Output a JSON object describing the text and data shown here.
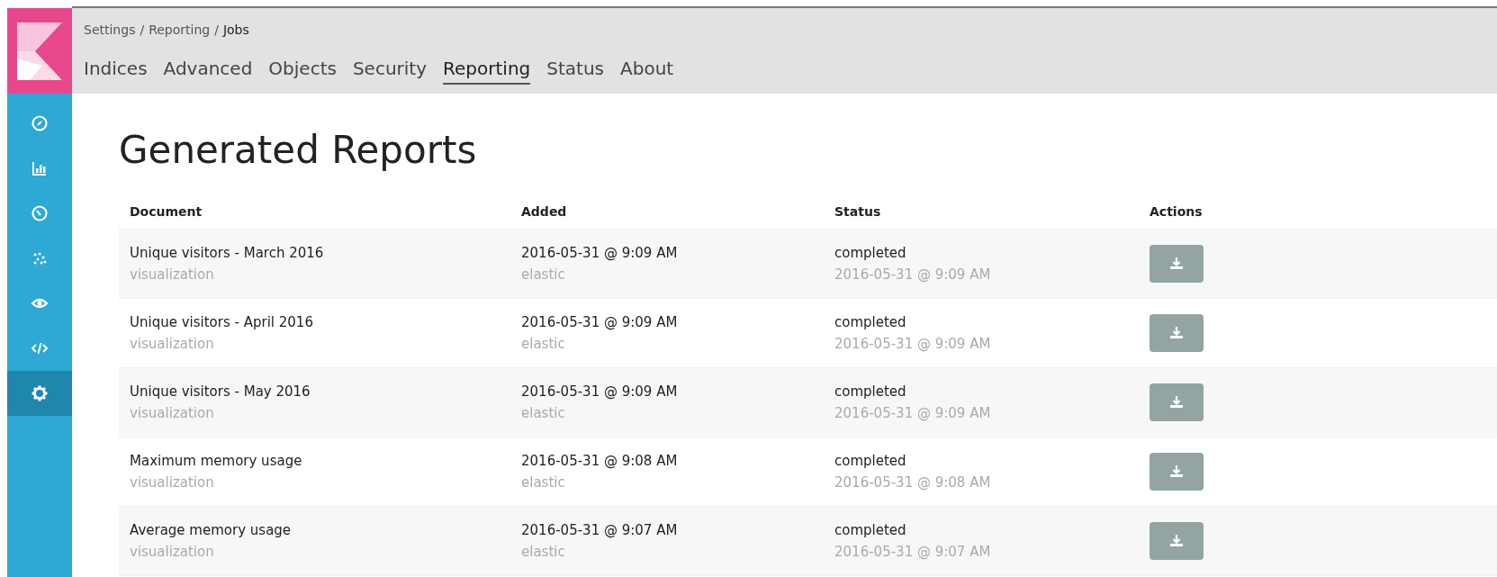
{
  "breadcrumb_separator": "/",
  "breadcrumb": [
    {
      "label": "Settings",
      "current": false
    },
    {
      "label": "Reporting",
      "current": false
    },
    {
      "label": "Jobs",
      "current": true
    }
  ],
  "tabs": [
    {
      "label": "Indices",
      "selected": false
    },
    {
      "label": "Advanced",
      "selected": false
    },
    {
      "label": "Objects",
      "selected": false
    },
    {
      "label": "Security",
      "selected": false
    },
    {
      "label": "Reporting",
      "selected": true
    },
    {
      "label": "Status",
      "selected": false
    },
    {
      "label": "About",
      "selected": false
    }
  ],
  "sidebar": {
    "items": [
      {
        "kind": "compass",
        "selected": false
      },
      {
        "kind": "chart",
        "selected": false
      },
      {
        "kind": "gauge",
        "selected": false
      },
      {
        "kind": "scatter",
        "selected": false
      },
      {
        "kind": "eye",
        "selected": false
      },
      {
        "kind": "code",
        "selected": false
      },
      {
        "kind": "gear",
        "selected": true
      }
    ]
  },
  "title": "Generated Reports",
  "table": {
    "columns": [
      "Document",
      "Added",
      "Status",
      "Actions"
    ],
    "rows": [
      {
        "document": "Unique visitors - March 2016",
        "type": "visualization",
        "added": "2016-05-31 @ 9:09 AM",
        "user": "elastic",
        "status": "completed",
        "status_time": "2016-05-31 @ 9:09 AM"
      },
      {
        "document": "Unique visitors - April 2016",
        "type": "visualization",
        "added": "2016-05-31 @ 9:09 AM",
        "user": "elastic",
        "status": "completed",
        "status_time": "2016-05-31 @ 9:09 AM"
      },
      {
        "document": "Unique visitors - May 2016",
        "type": "visualization",
        "added": "2016-05-31 @ 9:09 AM",
        "user": "elastic",
        "status": "completed",
        "status_time": "2016-05-31 @ 9:09 AM"
      },
      {
        "document": "Maximum memory usage",
        "type": "visualization",
        "added": "2016-05-31 @ 9:08 AM",
        "user": "elastic",
        "status": "completed",
        "status_time": "2016-05-31 @ 9:08 AM"
      },
      {
        "document": "Average memory usage",
        "type": "visualization",
        "added": "2016-05-31 @ 9:07 AM",
        "user": "elastic",
        "status": "completed",
        "status_time": "2016-05-31 @ 9:07 AM"
      }
    ]
  }
}
